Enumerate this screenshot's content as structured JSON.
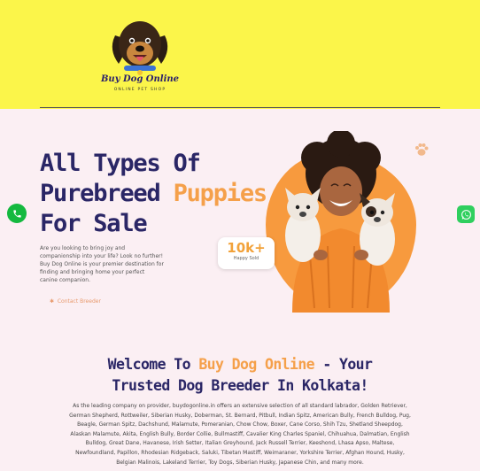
{
  "header": {
    "logo_title": "Buy Dog Online",
    "logo_subtitle": "ONLINE PET SHOP"
  },
  "hero": {
    "title_line1": "All Types Of",
    "title_line2_part1": "Purebreed ",
    "title_line2_accent": "Puppies",
    "title_line3": "For Sale",
    "description": "Are you looking to bring joy and companionship into your life? Look no further! Buy Dog Online is your premier destination for finding and bringing home your perfect canine companion.",
    "contact_label": "Contact Breeder",
    "stat_number": "10k+",
    "stat_label": "Happy Sold"
  },
  "welcome": {
    "part1": "Welcome To ",
    "accent": "Buy Dog Online",
    "part2": " - Your",
    "line2": "Trusted Dog Breeder In Kolkata!",
    "paragraph": "As the leading company on provider, buydogonline.in offers an extensive selection of all standard labrador, Golden Retriever, German Shepherd, Rottweiler, Siberian Husky, Doberman, St. Bernard, Pitbull, Indian Spitz, American Bully, French Bulldog, Pug, Beagle, German Spitz, Dachshund, Malamute, Pomeranian, Chow Chow, Boxer, Cane Corso, Shih Tzu, Shetland Sheepdog, Alaskan Malamute, Akita, English Bully, Border Collie, Bullmastiff, Cavalier King Charles Spaniel, Chihuahua, Dalmatian, English Bulldog, Great Dane, Havanese, Irish Setter, Italian Greyhound, Jack Russell Terrier, Keeshond, Lhasa Apso, Maltese, Newfoundland, Papillon, Rhodesian Ridgeback, Saluki, Tibetan Mastiff, Weimaraner, Yorkshire Terrier, Afghan Hound, Husky, Belgian Malinois, Lakeland Terrier, Toy Dogs, Siberian Husky, Japanese Chin, and many more."
  },
  "colors": {
    "header_bg": "#fbf54a",
    "page_bg": "#fbeff3",
    "title_navy": "#2a2666",
    "accent_orange": "#f5a04a",
    "call_green": "#14b93f",
    "whatsapp_green": "#2fcf5e"
  },
  "icons": {
    "call": "phone-icon",
    "whatsapp": "whatsapp-icon",
    "paw": "paw-icon",
    "contact": "paw-small-icon"
  }
}
